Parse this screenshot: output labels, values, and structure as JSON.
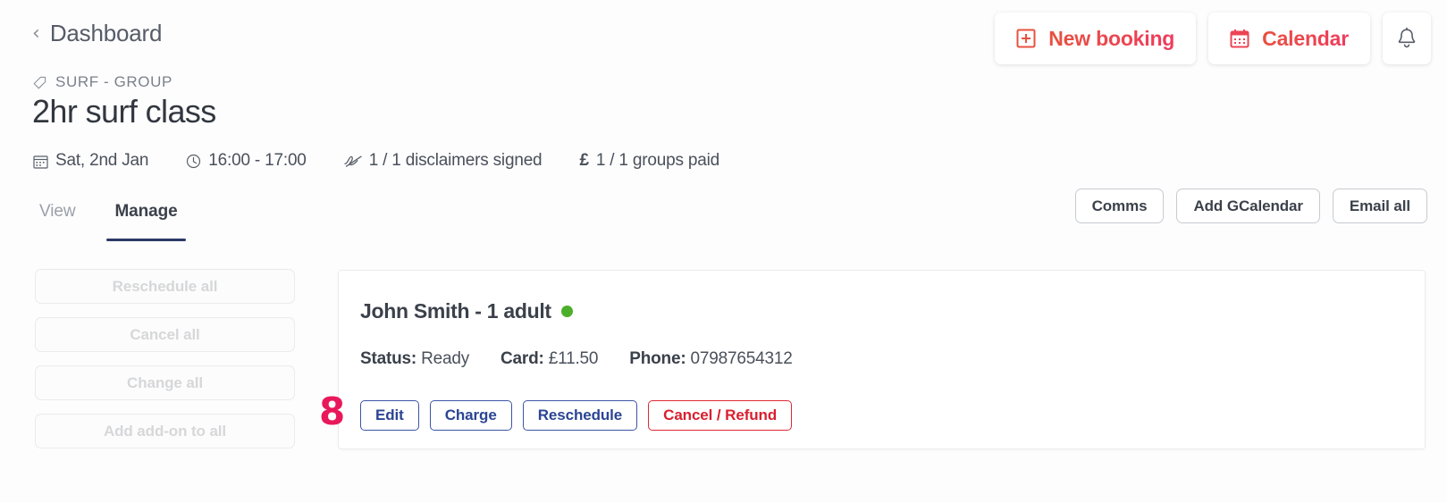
{
  "breadcrumb": {
    "label": "Dashboard",
    "chevron": "‹",
    "icon": "chevron-left-icon"
  },
  "topbar": {
    "buttons": [
      {
        "label": "New booking",
        "icon": "plus-square-icon"
      },
      {
        "label": "Calendar",
        "icon": "calendar-icon"
      }
    ],
    "bell": {
      "icon": "bell-icon"
    },
    "accent_start": "#e8513f",
    "accent_end": "#ef3b5e"
  },
  "header": {
    "category": "SURF - GROUP",
    "category_icon": "tag-icon",
    "title": "2hr surf class",
    "meta": [
      {
        "icon": "calendar-icon",
        "text": "Sat, 2nd Jan"
      },
      {
        "icon": "clock-icon",
        "text": "16:00 - 17:00"
      },
      {
        "icon": "signature-icon",
        "text": "1 / 1 disclaimers signed"
      },
      {
        "icon": "pound-icon",
        "text": "1 / 1 groups paid"
      }
    ]
  },
  "tabs": [
    {
      "label": "View",
      "active": false
    },
    {
      "label": "Manage",
      "active": true
    }
  ],
  "tab_underline_color": "#2b3a67",
  "secondary_buttons": [
    {
      "label": "Comms"
    },
    {
      "label": "Add GCalendar"
    },
    {
      "label": "Email all"
    }
  ],
  "side_actions": [
    {
      "label": "Reschedule all",
      "disabled": true
    },
    {
      "label": "Cancel all",
      "disabled": true
    },
    {
      "label": "Change all",
      "disabled": true
    },
    {
      "label": "Add add-on to all",
      "disabled": true
    }
  ],
  "booking_card": {
    "name": "John Smith - 1 adult",
    "status_dot_color": "#4caf2a",
    "fields": [
      {
        "label": "Status:",
        "value": "Ready"
      },
      {
        "label": "Card:",
        "value": "£11.50"
      },
      {
        "label": "Phone:",
        "value": "07987654312"
      }
    ],
    "actions": [
      {
        "label": "Edit",
        "style": "blue"
      },
      {
        "label": "Charge",
        "style": "blue"
      },
      {
        "label": "Reschedule",
        "style": "blue"
      },
      {
        "label": "Cancel / Refund",
        "style": "red"
      }
    ]
  },
  "annotation": {
    "number": "8",
    "color": "#e8195b"
  }
}
